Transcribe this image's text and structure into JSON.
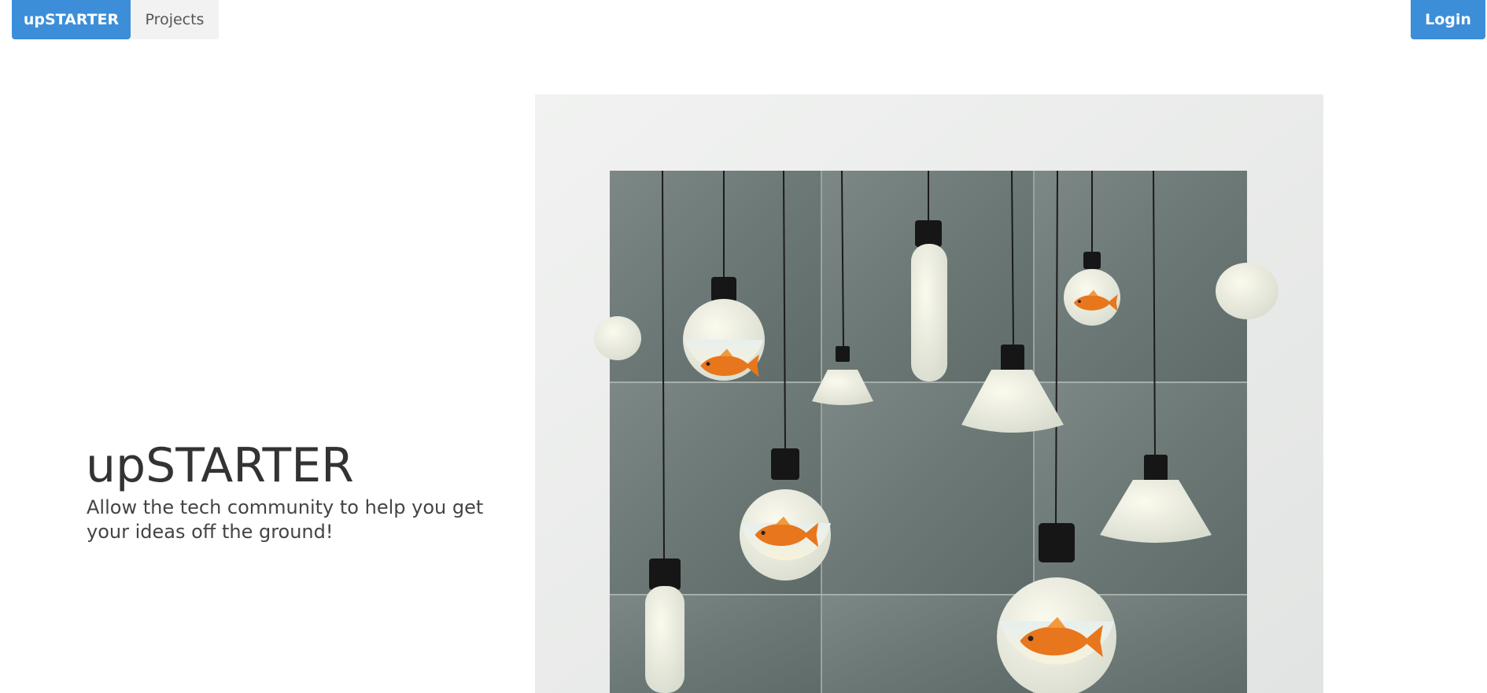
{
  "nav": {
    "brand_label": "upSTARTER",
    "projects_label": "Projects",
    "login_label": "Login"
  },
  "hero": {
    "title": "upSTARTER",
    "subtitle": "Allow the tech community to help you get your ideas off the ground!",
    "image_icon": "hanging-lightbulbs-goldfish-image"
  },
  "colors": {
    "accent": "#3d8ed8",
    "projects_bg": "#f2f2f2",
    "text": "#333333",
    "panel_bg": "#6e7a78",
    "wall_bg": "#ebedec"
  }
}
